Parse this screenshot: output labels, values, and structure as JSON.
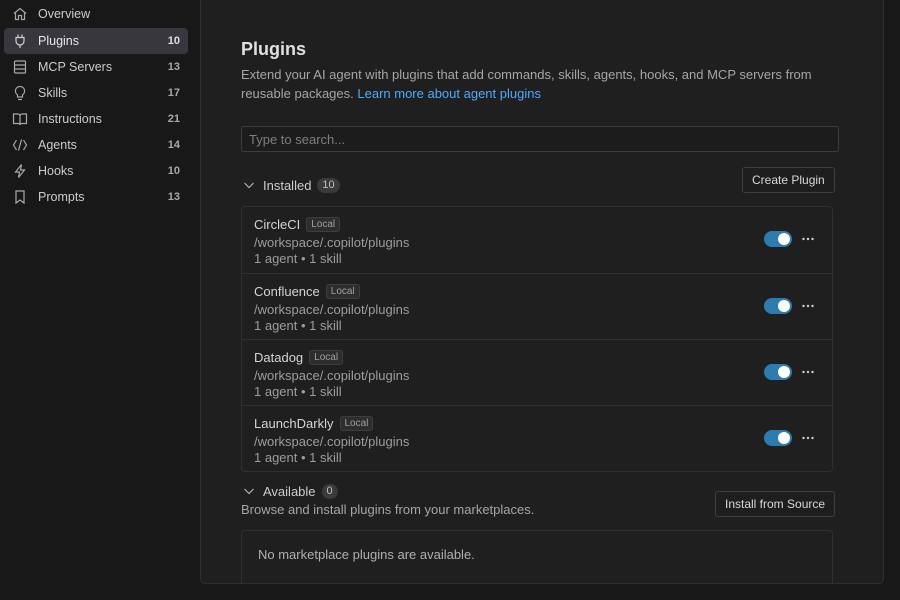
{
  "sidebar": {
    "items": [
      {
        "label": "Overview",
        "count": "",
        "icon": "home-icon"
      },
      {
        "label": "Plugins",
        "count": "10",
        "icon": "plug-icon"
      },
      {
        "label": "MCP Servers",
        "count": "13",
        "icon": "server-icon"
      },
      {
        "label": "Skills",
        "count": "17",
        "icon": "lightbulb-icon"
      },
      {
        "label": "Instructions",
        "count": "21",
        "icon": "book-icon"
      },
      {
        "label": "Agents",
        "count": "14",
        "icon": "code-icon"
      },
      {
        "label": "Hooks",
        "count": "10",
        "icon": "lightning-icon"
      },
      {
        "label": "Prompts",
        "count": "13",
        "icon": "bookmark-icon"
      }
    ],
    "active": "Plugins"
  },
  "main": {
    "title": "Plugins",
    "description": "Extend your AI agent with plugins that add commands, skills, agents, hooks, and MCP servers from reusable packages.",
    "learn_more": "Learn more about agent plugins",
    "search_placeholder": "Type to search...",
    "installed": {
      "label": "Installed",
      "count": "10",
      "create_button": "Create Plugin",
      "plugins": [
        {
          "name": "CircleCI",
          "tag": "Local",
          "path": "/workspace/.copilot/plugins",
          "meta": "1 agent • 1 skill",
          "enabled": true
        },
        {
          "name": "Confluence",
          "tag": "Local",
          "path": "/workspace/.copilot/plugins",
          "meta": "1 agent • 1 skill",
          "enabled": true
        },
        {
          "name": "Datadog",
          "tag": "Local",
          "path": "/workspace/.copilot/plugins",
          "meta": "1 agent • 1 skill",
          "enabled": true
        },
        {
          "name": "LaunchDarkly",
          "tag": "Local",
          "path": "/workspace/.copilot/plugins",
          "meta": "1 agent • 1 skill",
          "enabled": true
        }
      ]
    },
    "available": {
      "label": "Available",
      "count": "0",
      "description": "Browse and install plugins from your marketplaces.",
      "install_button": "Install from Source",
      "empty_text": "No marketplace plugins are available."
    }
  },
  "colors": {
    "background": "#181818",
    "panel": "#1f1f1f",
    "active_nav": "#37373d",
    "toggle_on": "#2e7bb0",
    "link": "#4daafc"
  }
}
